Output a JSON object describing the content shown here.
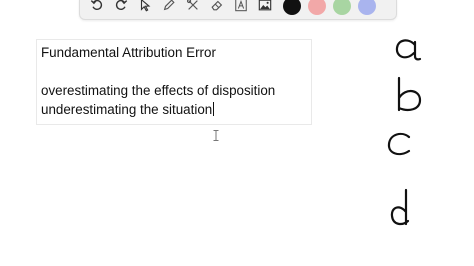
{
  "toolbar": {
    "tools": [
      {
        "icon": "undo-icon"
      },
      {
        "icon": "redo-icon"
      },
      {
        "icon": "select-arrow-icon"
      },
      {
        "icon": "pen-icon"
      },
      {
        "icon": "tools-icon"
      },
      {
        "icon": "eraser-icon"
      },
      {
        "icon": "text-icon"
      },
      {
        "icon": "image-icon"
      }
    ],
    "colors": [
      "#111111",
      "#f2a8a8",
      "#a8d5a2",
      "#a9b4ee"
    ]
  },
  "textbox": {
    "line1": "Fundamental Attribution Error",
    "line2": "overestimating the effects of disposition",
    "line3": "underestimating the situation"
  },
  "handwritten_letters": [
    "a",
    "b",
    "c",
    "d"
  ]
}
